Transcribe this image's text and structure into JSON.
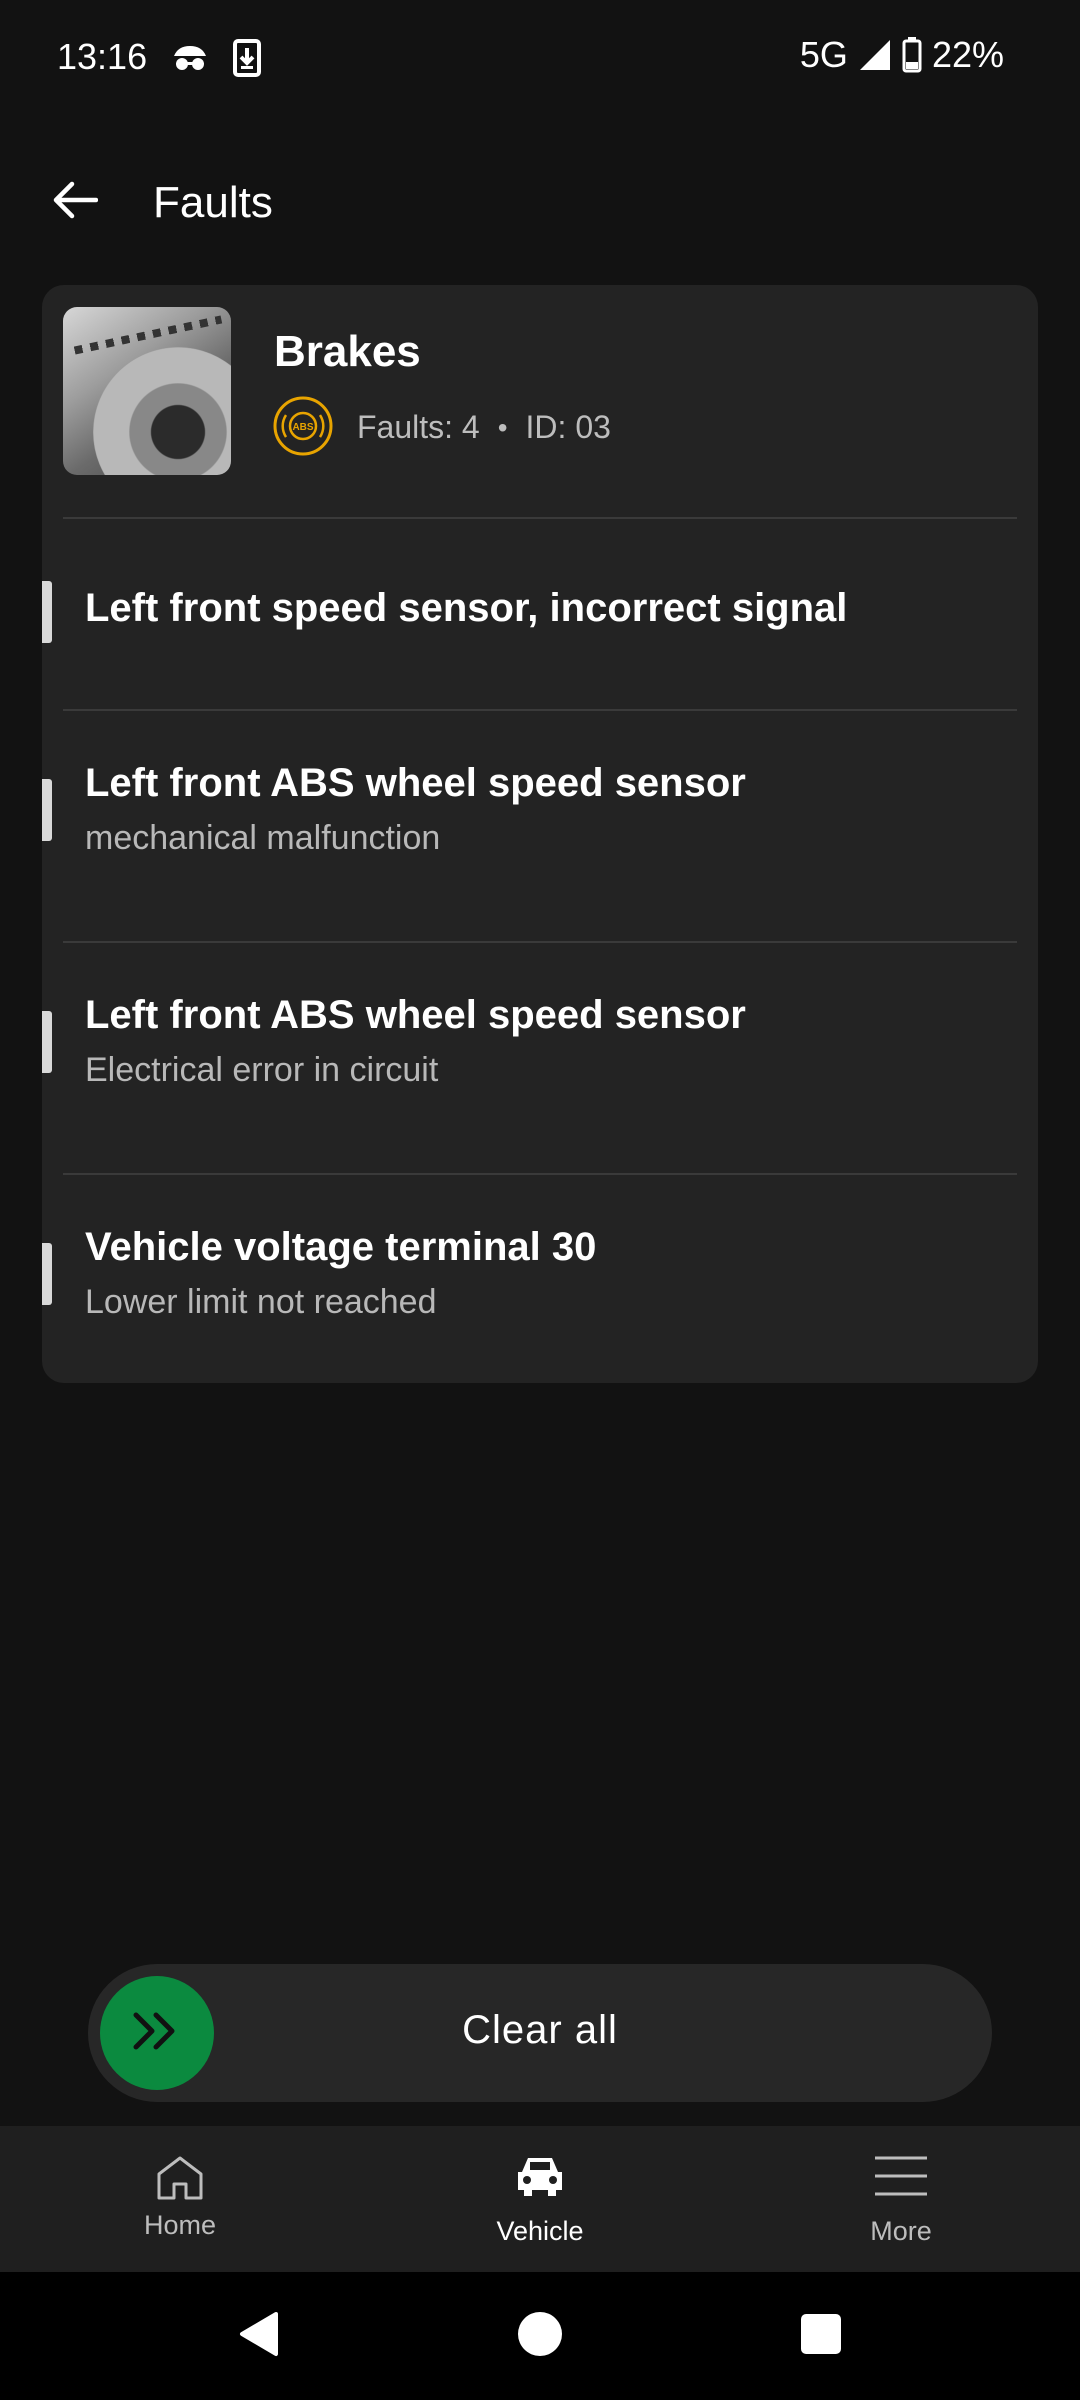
{
  "status_bar": {
    "time": "13:16",
    "network": "5G",
    "battery": "22%",
    "icons": [
      "incognito-icon",
      "download-icon",
      "signal-icon",
      "battery-icon"
    ]
  },
  "app_bar": {
    "title": "Faults",
    "back_icon": "arrow-left-icon"
  },
  "module": {
    "name": "Brakes",
    "badge_icon": "abs-warning-icon",
    "badge_text": "ABS",
    "faults": "Faults: 4",
    "separator": "•",
    "id": "ID: 03"
  },
  "faults": [
    {
      "title": "Left front speed sensor, incorrect signal",
      "subtitle": ""
    },
    {
      "title": "Left front ABS wheel speed sensor",
      "subtitle": "mechanical malfunction"
    },
    {
      "title": "Left front ABS wheel speed sensor",
      "subtitle": "Electrical error in circuit"
    },
    {
      "title": "Vehicle voltage terminal 30",
      "subtitle": "Lower limit not reached"
    }
  ],
  "clear_action": {
    "label": "Clear all",
    "icon": "double-chevron-right-icon"
  },
  "bottom_nav": {
    "items": [
      {
        "label": "Home",
        "icon": "home-icon",
        "active": false
      },
      {
        "label": "Vehicle",
        "icon": "car-icon",
        "active": true
      },
      {
        "label": "More",
        "icon": "menu-icon",
        "active": false
      }
    ]
  },
  "colors": {
    "background": "#121212",
    "card": "#232323",
    "accent_green": "#0b8a3f",
    "abs_amber": "#e8a400",
    "active_label": "#ffffff",
    "inactive_label": "#bdbdbd"
  }
}
